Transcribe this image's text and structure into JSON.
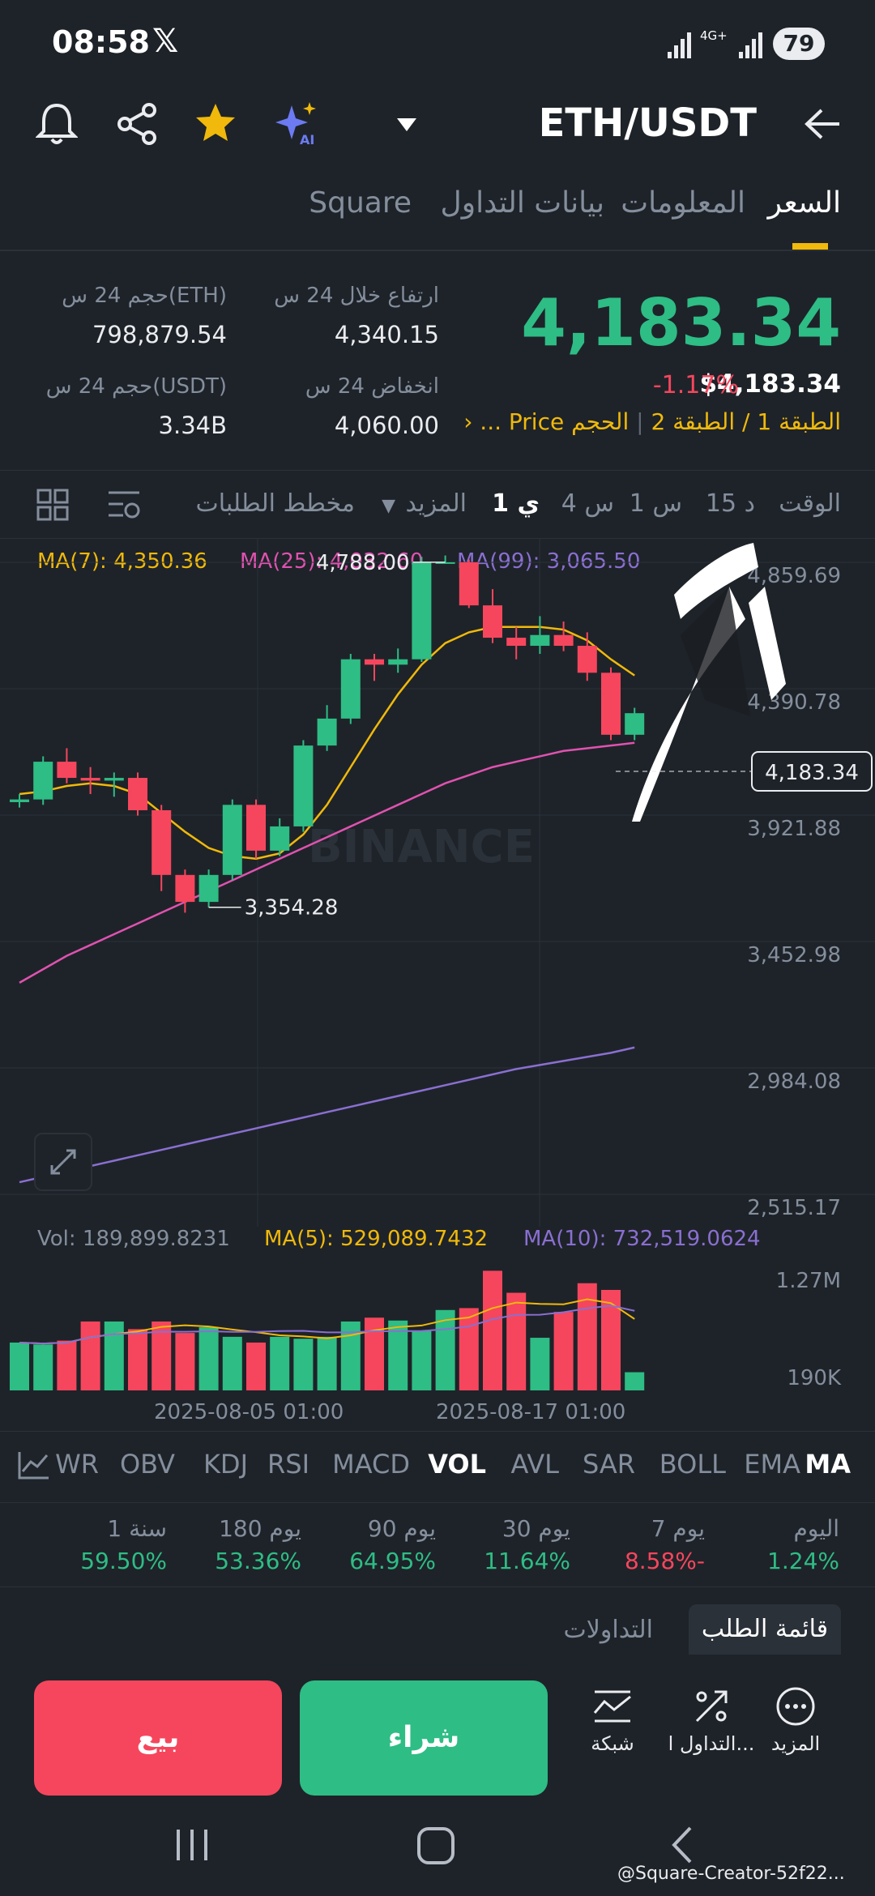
{
  "status": {
    "time": "08:58",
    "network": "4G+",
    "battery": "79"
  },
  "header": {
    "pair": "ETH/USDT",
    "icons": [
      "bell-icon",
      "share-icon",
      "star-icon",
      "ai-sparkle-icon",
      "back-arrow-icon"
    ]
  },
  "tabs": {
    "price": "السعر",
    "info": "المعلومات",
    "trading_data": "بيانات التداول",
    "square": "Square"
  },
  "ticker": {
    "price": "4,183.34",
    "change": "-1.17%",
    "usd_price": "$4,183.34",
    "high_label": "ارتفاع خلال 24 س",
    "high": "4,340.15",
    "low_label": "انخفاض 24 س",
    "low": "4,060.00",
    "vol_eth_label": "حجم 24 س(ETH)",
    "vol_eth": "798,879.54",
    "vol_usdt_label": "حجم 24 س(USDT)",
    "vol_usdt": "3.34B",
    "layer1": "الطبقة 1",
    "sep": "/",
    "layer2": "الطبقة 2",
    "sep2": "|",
    "volume_tag": "الحجم",
    "price_tag": "Price ..."
  },
  "timeframes": {
    "label": "الوقت",
    "m15": "15 د",
    "h1": "1 س",
    "h4": "4 س",
    "d1": "1 ي",
    "more": "المزيد",
    "depth": "مخطط الطلبات"
  },
  "ma_legend": {
    "ma7": "MA(7): 4,350.36",
    "ma25": "MA(25): 4,032.60",
    "ma99": "MA(99): 3,065.50"
  },
  "colors": {
    "up": "#2ebd85",
    "down": "#f6465d",
    "ma7": "#f0b90b",
    "ma25": "#e052b0",
    "ma99": "#8a6fd1",
    "accent": "#f0b90b"
  },
  "chart_data": {
    "type": "candlestick",
    "price_axis": [
      "4,859.69",
      "4,390.78",
      "3,921.88",
      "3,452.98",
      "2,984.08",
      "2,515.17"
    ],
    "current_price_label": "4,183.34",
    "high_marker": "4,788.00",
    "low_marker": "3,354.28",
    "watermark": "BINANCE",
    "candles": [
      {
        "o": 3970,
        "c": 3980,
        "h": 4000,
        "l": 3950
      },
      {
        "o": 3980,
        "c": 4120,
        "h": 4140,
        "l": 3960
      },
      {
        "o": 4120,
        "c": 4060,
        "h": 4170,
        "l": 4040
      },
      {
        "o": 4060,
        "c": 4050,
        "h": 4100,
        "l": 4000
      },
      {
        "o": 4050,
        "c": 4060,
        "h": 4080,
        "l": 3990
      },
      {
        "o": 4060,
        "c": 3940,
        "h": 4080,
        "l": 3920
      },
      {
        "o": 3940,
        "c": 3700,
        "h": 3960,
        "l": 3640
      },
      {
        "o": 3700,
        "c": 3600,
        "h": 3720,
        "l": 3560
      },
      {
        "o": 3600,
        "c": 3700,
        "h": 3720,
        "l": 3580
      },
      {
        "o": 3700,
        "c": 3960,
        "h": 3980,
        "l": 3680
      },
      {
        "o": 3960,
        "c": 3790,
        "h": 3980,
        "l": 3760
      },
      {
        "o": 3790,
        "c": 3880,
        "h": 3910,
        "l": 3770
      },
      {
        "o": 3880,
        "c": 4180,
        "h": 4200,
        "l": 3860
      },
      {
        "o": 4180,
        "c": 4280,
        "h": 4330,
        "l": 4160
      },
      {
        "o": 4280,
        "c": 4500,
        "h": 4520,
        "l": 4260
      },
      {
        "o": 4500,
        "c": 4480,
        "h": 4520,
        "l": 4420
      },
      {
        "o": 4480,
        "c": 4500,
        "h": 4540,
        "l": 4450
      },
      {
        "o": 4500,
        "c": 4860,
        "h": 4880,
        "l": 4490
      },
      {
        "o": 4860,
        "c": 4860,
        "h": 4885,
        "l": 4860
      },
      {
        "o": 4860,
        "c": 4700,
        "h": 4870,
        "l": 4690
      },
      {
        "o": 4700,
        "c": 4580,
        "h": 4760,
        "l": 4560
      },
      {
        "o": 4580,
        "c": 4550,
        "h": 4620,
        "l": 4500
      },
      {
        "o": 4550,
        "c": 4590,
        "h": 4660,
        "l": 4520
      },
      {
        "o": 4590,
        "c": 4550,
        "h": 4640,
        "l": 4530
      },
      {
        "o": 4550,
        "c": 4450,
        "h": 4600,
        "l": 4420
      },
      {
        "o": 4450,
        "c": 4220,
        "h": 4470,
        "l": 4200
      },
      {
        "o": 4220,
        "c": 4300,
        "h": 4320,
        "l": 4200
      }
    ],
    "ma7": [
      4000,
      4010,
      4030,
      4040,
      4030,
      4000,
      3930,
      3860,
      3800,
      3770,
      3760,
      3780,
      3850,
      3960,
      4100,
      4240,
      4370,
      4480,
      4560,
      4600,
      4620,
      4620,
      4620,
      4610,
      4570,
      4500,
      4440
    ],
    "ma25": [
      3300,
      3350,
      3400,
      3440,
      3480,
      3520,
      3560,
      3600,
      3640,
      3680,
      3720,
      3760,
      3800,
      3840,
      3880,
      3920,
      3960,
      4000,
      4040,
      4070,
      4100,
      4120,
      4140,
      4160,
      4170,
      4180,
      4190
    ],
    "ma99": [
      2560,
      2580,
      2600,
      2620,
      2640,
      2660,
      2680,
      2700,
      2720,
      2740,
      2760,
      2780,
      2800,
      2820,
      2840,
      2860,
      2880,
      2900,
      2920,
      2940,
      2960,
      2980,
      2995,
      3010,
      3025,
      3040,
      3060
    ],
    "volume": {
      "legend": {
        "vol": "Vol: 189,899.8231",
        "ma5": "MA(5): 529,089.7432",
        "ma10": "MA(10): 732,519.0624"
      },
      "axis": [
        "1.27M",
        "190K"
      ],
      "values": [
        500,
        480,
        520,
        720,
        720,
        640,
        720,
        600,
        660,
        560,
        500,
        560,
        540,
        560,
        720,
        760,
        730,
        620,
        840,
        860,
        1250,
        1020,
        550,
        820,
        1120,
        1050,
        190
      ]
    },
    "dates": [
      "2025-08-05 01:00",
      "2025-08-17 01:00"
    ]
  },
  "indicators": {
    "ma": "MA",
    "ema": "EMA",
    "boll": "BOLL",
    "sar": "SAR",
    "avl": "AVL",
    "vol": "VOL",
    "macd": "MACD",
    "rsi": "RSI",
    "kdj": "KDJ",
    "obv": "OBV",
    "wr": "WR"
  },
  "performance": [
    {
      "label": "اليوم",
      "value": "1.24%",
      "up": true
    },
    {
      "label": "7 يوم",
      "value": "8.58%-",
      "up": false
    },
    {
      "label": "30 يوم",
      "value": "11.64%",
      "up": true
    },
    {
      "label": "90 يوم",
      "value": "64.95%",
      "up": true
    },
    {
      "label": "180 يوم",
      "value": "53.36%",
      "up": true
    },
    {
      "label": "1 سنة",
      "value": "59.50%",
      "up": true
    }
  ],
  "book_tabs": {
    "order_book": "قائمة الطلب",
    "trades": "التداولات"
  },
  "actions": {
    "more": "المزيد",
    "trade": "التداول ا...",
    "grid": "شبكة",
    "buy": "شراء",
    "sell": "بيع"
  },
  "watermark_user": "@Square-Creator-52f22..."
}
